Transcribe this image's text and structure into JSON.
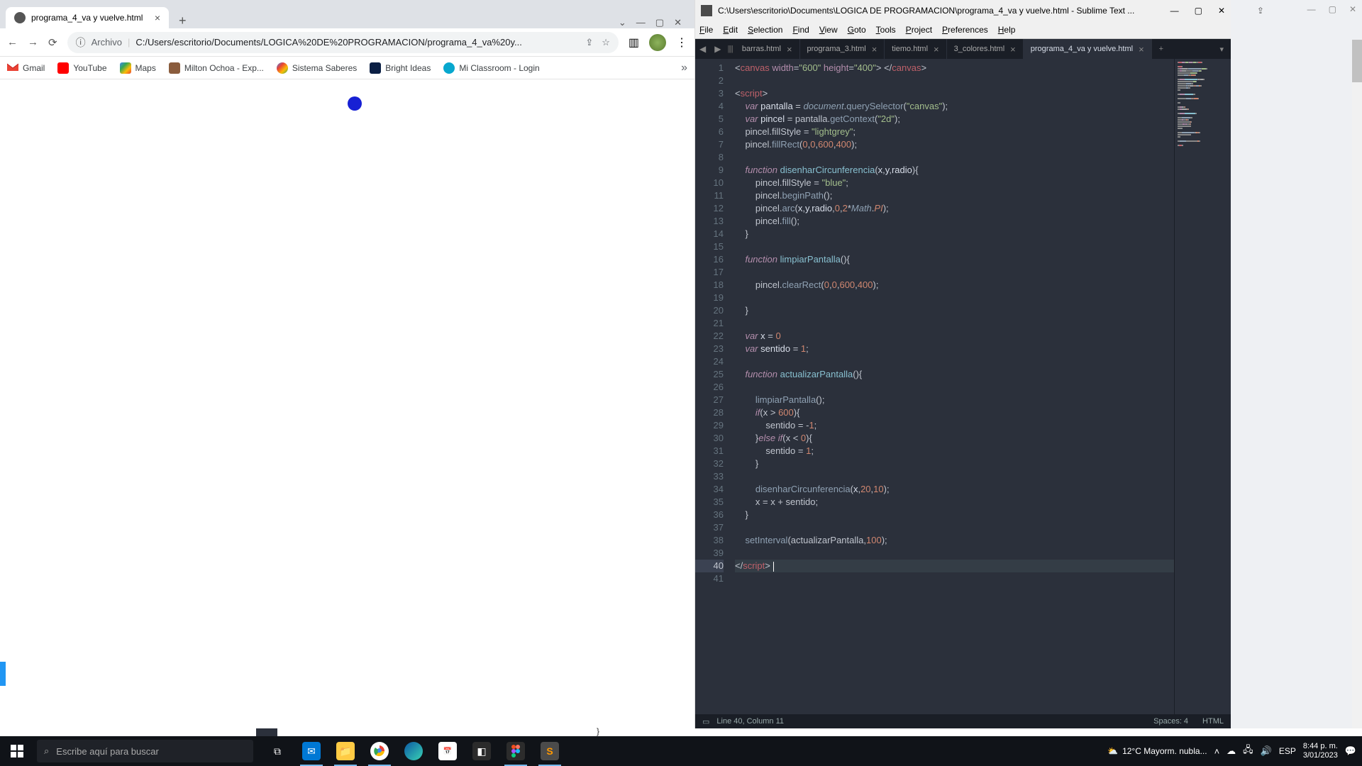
{
  "chrome": {
    "tab_title": "programa_4_va y vuelve.html",
    "addr_label": "Archivo",
    "addr_url": "C:/Users/escritorio/Documents/LOGICA%20DE%20PROGRAMACION/programa_4_va%20y...",
    "bookmarks": [
      "Gmail",
      "YouTube",
      "Maps",
      "Milton Ochoa - Exp...",
      "Sistema Saberes",
      "Bright Ideas",
      "Mi Classroom - Login"
    ]
  },
  "sublime": {
    "title": "C:\\Users\\escritorio\\Documents\\LOGICA DE PROGRAMACION\\programa_4_va y vuelve.html - Sublime Text ...",
    "menu": [
      "File",
      "Edit",
      "Selection",
      "Find",
      "View",
      "Goto",
      "Tools",
      "Project",
      "Preferences",
      "Help"
    ],
    "tabs": [
      "barras.html",
      "programa_3.html",
      "tiemo.html",
      "3_colores.html",
      "programa_4_va y vuelve.html"
    ],
    "active_tab": 4,
    "status_left": "Line 40, Column 11",
    "status_spaces": "Spaces: 4",
    "status_lang": "HTML",
    "line_count": 41,
    "selected_line": 40
  },
  "taskbar": {
    "search_placeholder": "Escribe aquí para buscar",
    "weather": "12°C  Mayorm. nubla...",
    "time": "8:44 p. m.",
    "date": "3/01/2023",
    "lang": "ESP"
  },
  "code_lines": [
    {
      "n": 1,
      "seg": [
        [
          "p",
          "<"
        ],
        [
          "tag",
          "canvas"
        ],
        [
          "p",
          " "
        ],
        [
          "attr",
          "width"
        ],
        [
          "op",
          "="
        ],
        [
          "str",
          "\"600\""
        ],
        [
          "p",
          " "
        ],
        [
          "attr",
          "height"
        ],
        [
          "op",
          "="
        ],
        [
          "str",
          "\"400\""
        ],
        [
          "p",
          "> </"
        ],
        [
          "tag",
          "canvas"
        ],
        [
          "p",
          ">"
        ]
      ]
    },
    {
      "n": 2,
      "seg": []
    },
    {
      "n": 3,
      "seg": [
        [
          "p",
          "<"
        ],
        [
          "tag",
          "script"
        ],
        [
          "p",
          ">"
        ]
      ]
    },
    {
      "n": 4,
      "seg": [
        [
          "p",
          "    "
        ],
        [
          "kw",
          "var"
        ],
        [
          "p",
          " "
        ],
        [
          "id",
          "pantalla "
        ],
        [
          "op",
          "="
        ],
        [
          "p",
          " "
        ],
        [
          "it",
          "document"
        ],
        [
          "p",
          "."
        ],
        [
          "fn",
          "querySelector"
        ],
        [
          "p",
          "("
        ],
        [
          "str",
          "\"canvas\""
        ],
        [
          "p",
          ");"
        ]
      ]
    },
    {
      "n": 5,
      "seg": [
        [
          "p",
          "    "
        ],
        [
          "kw",
          "var"
        ],
        [
          "p",
          " "
        ],
        [
          "id",
          "pincel "
        ],
        [
          "op",
          "="
        ],
        [
          "p",
          " pantalla."
        ],
        [
          "fn",
          "getContext"
        ],
        [
          "p",
          "("
        ],
        [
          "str",
          "\"2d\""
        ],
        [
          "p",
          ");"
        ]
      ]
    },
    {
      "n": 6,
      "seg": [
        [
          "p",
          "    pincel.fillStyle "
        ],
        [
          "op",
          "="
        ],
        [
          "p",
          " "
        ],
        [
          "str",
          "\"lightgrey\""
        ],
        [
          "p",
          ";"
        ]
      ]
    },
    {
      "n": 7,
      "seg": [
        [
          "p",
          "    pincel."
        ],
        [
          "fn",
          "fillRect"
        ],
        [
          "p",
          "("
        ],
        [
          "num",
          "0"
        ],
        [
          "p",
          ","
        ],
        [
          "num",
          "0"
        ],
        [
          "p",
          ","
        ],
        [
          "num",
          "600"
        ],
        [
          "p",
          ","
        ],
        [
          "num",
          "400"
        ],
        [
          "p",
          ");"
        ]
      ]
    },
    {
      "n": 8,
      "seg": []
    },
    {
      "n": 9,
      "seg": [
        [
          "p",
          "    "
        ],
        [
          "kw",
          "function"
        ],
        [
          "p",
          " "
        ],
        [
          "fn2",
          "disenharCircunferencia"
        ],
        [
          "p",
          "("
        ],
        [
          "id",
          "x"
        ],
        [
          "p",
          ","
        ],
        [
          "id",
          "y"
        ],
        [
          "p",
          ","
        ],
        [
          "id",
          "radio"
        ],
        [
          "p",
          "){"
        ]
      ]
    },
    {
      "n": 10,
      "seg": [
        [
          "p",
          "        pincel.fillStyle "
        ],
        [
          "op",
          "="
        ],
        [
          "p",
          " "
        ],
        [
          "str",
          "\"blue\""
        ],
        [
          "p",
          ";"
        ]
      ]
    },
    {
      "n": 11,
      "seg": [
        [
          "p",
          "        pincel."
        ],
        [
          "fn",
          "beginPath"
        ],
        [
          "p",
          "();"
        ]
      ]
    },
    {
      "n": 12,
      "seg": [
        [
          "p",
          "        pincel."
        ],
        [
          "fn",
          "arc"
        ],
        [
          "p",
          "("
        ],
        [
          "id",
          "x"
        ],
        [
          "p",
          ","
        ],
        [
          "id",
          "y"
        ],
        [
          "p",
          ","
        ],
        [
          "id",
          "radio"
        ],
        [
          "p",
          ","
        ],
        [
          "num",
          "0"
        ],
        [
          "p",
          ","
        ],
        [
          "num",
          "2"
        ],
        [
          "op",
          "*"
        ],
        [
          "it",
          "Math"
        ],
        [
          "p",
          "."
        ],
        [
          "const",
          "PI"
        ],
        [
          "p",
          ");"
        ]
      ]
    },
    {
      "n": 13,
      "seg": [
        [
          "p",
          "        pincel."
        ],
        [
          "fn",
          "fill"
        ],
        [
          "p",
          "();"
        ]
      ]
    },
    {
      "n": 14,
      "seg": [
        [
          "p",
          "    }"
        ]
      ]
    },
    {
      "n": 15,
      "seg": []
    },
    {
      "n": 16,
      "seg": [
        [
          "p",
          "    "
        ],
        [
          "kw",
          "function"
        ],
        [
          "p",
          " "
        ],
        [
          "fn2",
          "limpiarPantalla"
        ],
        [
          "p",
          "(){"
        ]
      ]
    },
    {
      "n": 17,
      "seg": []
    },
    {
      "n": 18,
      "seg": [
        [
          "p",
          "        pincel."
        ],
        [
          "fn",
          "clearRect"
        ],
        [
          "p",
          "("
        ],
        [
          "num",
          "0"
        ],
        [
          "p",
          ","
        ],
        [
          "num",
          "0"
        ],
        [
          "p",
          ","
        ],
        [
          "num",
          "600"
        ],
        [
          "p",
          ","
        ],
        [
          "num",
          "400"
        ],
        [
          "p",
          ");"
        ]
      ]
    },
    {
      "n": 19,
      "seg": []
    },
    {
      "n": 20,
      "seg": [
        [
          "p",
          "    }"
        ]
      ]
    },
    {
      "n": 21,
      "seg": []
    },
    {
      "n": 22,
      "seg": [
        [
          "p",
          "    "
        ],
        [
          "kw",
          "var"
        ],
        [
          "p",
          " "
        ],
        [
          "id",
          "x "
        ],
        [
          "op",
          "="
        ],
        [
          "p",
          " "
        ],
        [
          "num",
          "0"
        ]
      ]
    },
    {
      "n": 23,
      "seg": [
        [
          "p",
          "    "
        ],
        [
          "kw",
          "var"
        ],
        [
          "p",
          " "
        ],
        [
          "id",
          "sentido "
        ],
        [
          "op",
          "="
        ],
        [
          "p",
          " "
        ],
        [
          "num",
          "1"
        ],
        [
          "p",
          ";"
        ]
      ]
    },
    {
      "n": 24,
      "seg": []
    },
    {
      "n": 25,
      "seg": [
        [
          "p",
          "    "
        ],
        [
          "kw",
          "function"
        ],
        [
          "p",
          " "
        ],
        [
          "fn2",
          "actualizarPantalla"
        ],
        [
          "p",
          "(){"
        ]
      ]
    },
    {
      "n": 26,
      "seg": []
    },
    {
      "n": 27,
      "seg": [
        [
          "p",
          "        "
        ],
        [
          "fn",
          "limpiarPantalla"
        ],
        [
          "p",
          "();"
        ]
      ]
    },
    {
      "n": 28,
      "seg": [
        [
          "p",
          "        "
        ],
        [
          "kw",
          "if"
        ],
        [
          "p",
          "(x "
        ],
        [
          "op",
          ">"
        ],
        [
          "p",
          " "
        ],
        [
          "num",
          "600"
        ],
        [
          "p",
          "){"
        ]
      ]
    },
    {
      "n": 29,
      "seg": [
        [
          "p",
          "            sentido "
        ],
        [
          "op",
          "="
        ],
        [
          "p",
          " "
        ],
        [
          "op",
          "-"
        ],
        [
          "num",
          "1"
        ],
        [
          "p",
          ";"
        ]
      ]
    },
    {
      "n": 30,
      "seg": [
        [
          "p",
          "        }"
        ],
        [
          "kw",
          "else"
        ],
        [
          "p",
          " "
        ],
        [
          "kw",
          "if"
        ],
        [
          "p",
          "(x "
        ],
        [
          "op",
          "<"
        ],
        [
          "p",
          " "
        ],
        [
          "num",
          "0"
        ],
        [
          "p",
          "){"
        ]
      ]
    },
    {
      "n": 31,
      "seg": [
        [
          "p",
          "            sentido "
        ],
        [
          "op",
          "="
        ],
        [
          "p",
          " "
        ],
        [
          "num",
          "1"
        ],
        [
          "p",
          ";"
        ]
      ]
    },
    {
      "n": 32,
      "seg": [
        [
          "p",
          "        }"
        ]
      ]
    },
    {
      "n": 33,
      "seg": []
    },
    {
      "n": 34,
      "seg": [
        [
          "p",
          "        "
        ],
        [
          "fn",
          "disenharCircunferencia"
        ],
        [
          "p",
          "("
        ],
        [
          "id",
          "x"
        ],
        [
          "p",
          ","
        ],
        [
          "num",
          "20"
        ],
        [
          "p",
          ","
        ],
        [
          "num",
          "10"
        ],
        [
          "p",
          ");"
        ]
      ]
    },
    {
      "n": 35,
      "seg": [
        [
          "p",
          "        x "
        ],
        [
          "op",
          "="
        ],
        [
          "p",
          " x "
        ],
        [
          "op",
          "+"
        ],
        [
          "p",
          " sentido;"
        ]
      ]
    },
    {
      "n": 36,
      "seg": [
        [
          "p",
          "    }"
        ]
      ]
    },
    {
      "n": 37,
      "seg": []
    },
    {
      "n": 38,
      "seg": [
        [
          "p",
          "    "
        ],
        [
          "fn",
          "setInterval"
        ],
        [
          "p",
          "(actualizarPantalla,"
        ],
        [
          "num",
          "100"
        ],
        [
          "p",
          ");"
        ]
      ]
    },
    {
      "n": 39,
      "seg": []
    },
    {
      "n": 40,
      "seg": [
        [
          "p",
          "</"
        ],
        [
          "tag",
          "script"
        ],
        [
          "p",
          "> "
        ]
      ],
      "cursor": true
    },
    {
      "n": 41,
      "seg": []
    }
  ]
}
